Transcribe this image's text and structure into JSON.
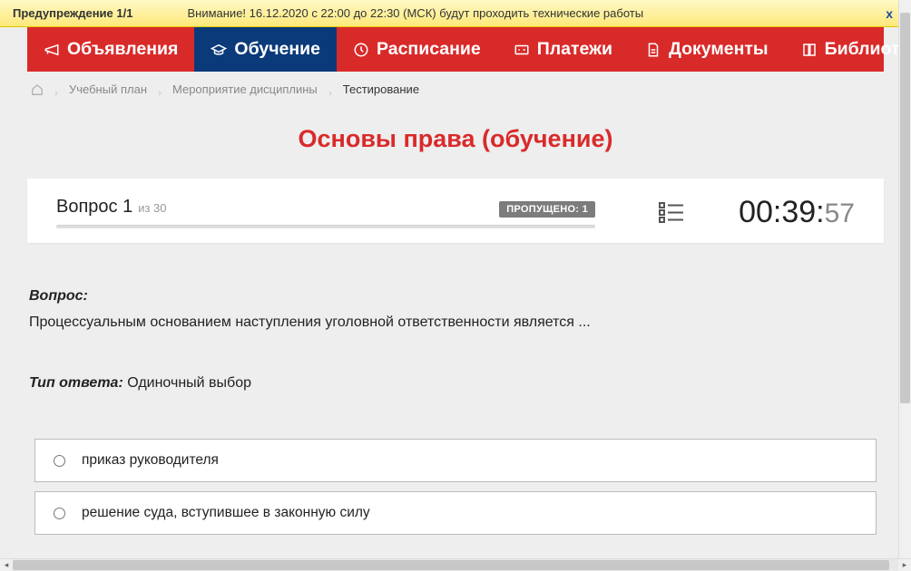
{
  "warning": {
    "title": "Предупреждение 1/1",
    "message": "Внимание! 16.12.2020 с 22:00 до 22:30 (МСК) будут проходить технические работы",
    "close": "x"
  },
  "nav": {
    "items": [
      {
        "label": "Объявления"
      },
      {
        "label": "Обучение"
      },
      {
        "label": "Расписание"
      },
      {
        "label": "Платежи"
      },
      {
        "label": "Документы"
      },
      {
        "label": "Библиотека"
      }
    ]
  },
  "breadcrumb": {
    "items": [
      {
        "label": "Учебный план"
      },
      {
        "label": "Мероприятие дисциплины"
      }
    ],
    "current": "Тестирование"
  },
  "page_title": "Основы права (обучение)",
  "test_header": {
    "question_label": "Вопрос 1",
    "total": "из 30",
    "skipped": "ПРОПУЩЕНО: 1",
    "timer_main": "00:39:",
    "timer_sec": "57"
  },
  "question": {
    "label": "Вопрос:",
    "text": "Процессуальным основанием наступления уголовной ответственности является ...",
    "answer_type_label": "Тип ответа:",
    "answer_type": " Одиночный выбор",
    "answers": [
      {
        "text": "приказ руководителя"
      },
      {
        "text": "решение суда, вступившее в законную силу"
      }
    ]
  }
}
